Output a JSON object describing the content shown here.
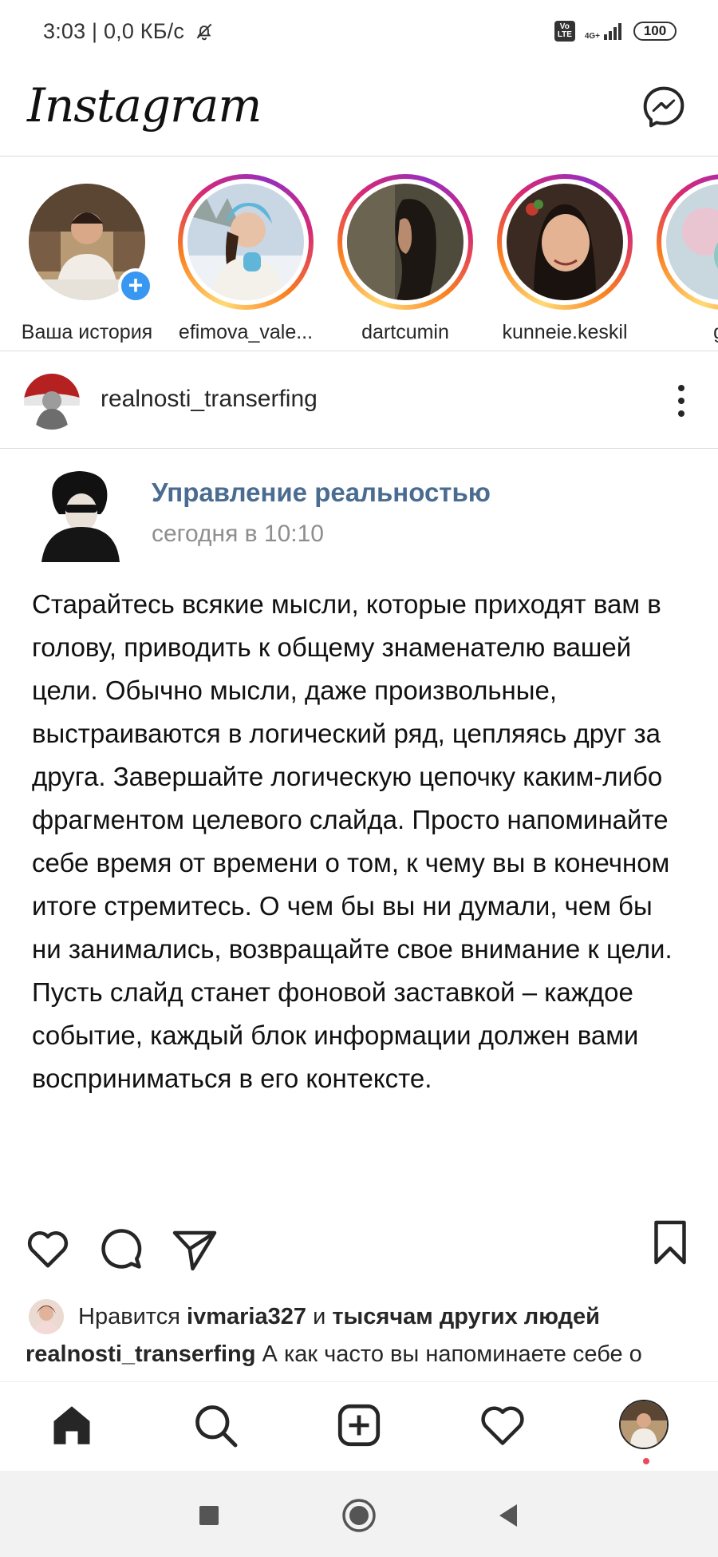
{
  "status_bar": {
    "time": "3:03 | 0,0 КБ/с",
    "volte": "Vo LTE",
    "network": "4G+",
    "battery": "100"
  },
  "header": {
    "logo": "Instagram",
    "messenger_icon": "messenger-icon"
  },
  "stories": [
    {
      "name": "Ваша история",
      "own": true
    },
    {
      "name": "efimova_vale..."
    },
    {
      "name": "dartcumin"
    },
    {
      "name": "kunneie.keskil"
    },
    {
      "name": "ga"
    }
  ],
  "post": {
    "username": "realnosti_transerfing",
    "image": {
      "source_title": "Управление реальностью",
      "source_time": "сегодня в 10:10",
      "text": "Старайтесь всякие мысли, которые приходят вам в голову, приводить к общему знаменателю вашей цели. Обычно мысли, даже произвольные, выстраиваются в логический ряд, цепляясь друг за друга. Завершайте логическую цепочку каким-либо фрагментом целевого слайда. Просто напоминайте себе время от времени о том, к чему вы в конечном итоге стремитесь. О чем бы вы ни думали, чем бы ни занимались, возвращайте свое внимание к цели. Пусть слайд станет фоновой заставкой – каждое событие, каждый блок информации должен вами восприниматься в его контексте."
    },
    "likes": {
      "prefix": "Нравится",
      "user": "ivmaria327",
      "middle": "и",
      "others": "тысячам других людей"
    },
    "caption": {
      "username": "realnosti_transerfing",
      "text": "А как часто вы напоминаете себе о"
    }
  },
  "colors": {
    "accent_blue": "#3897f0",
    "vk_title": "#4a6c91",
    "notification_red": "#ed4956"
  }
}
